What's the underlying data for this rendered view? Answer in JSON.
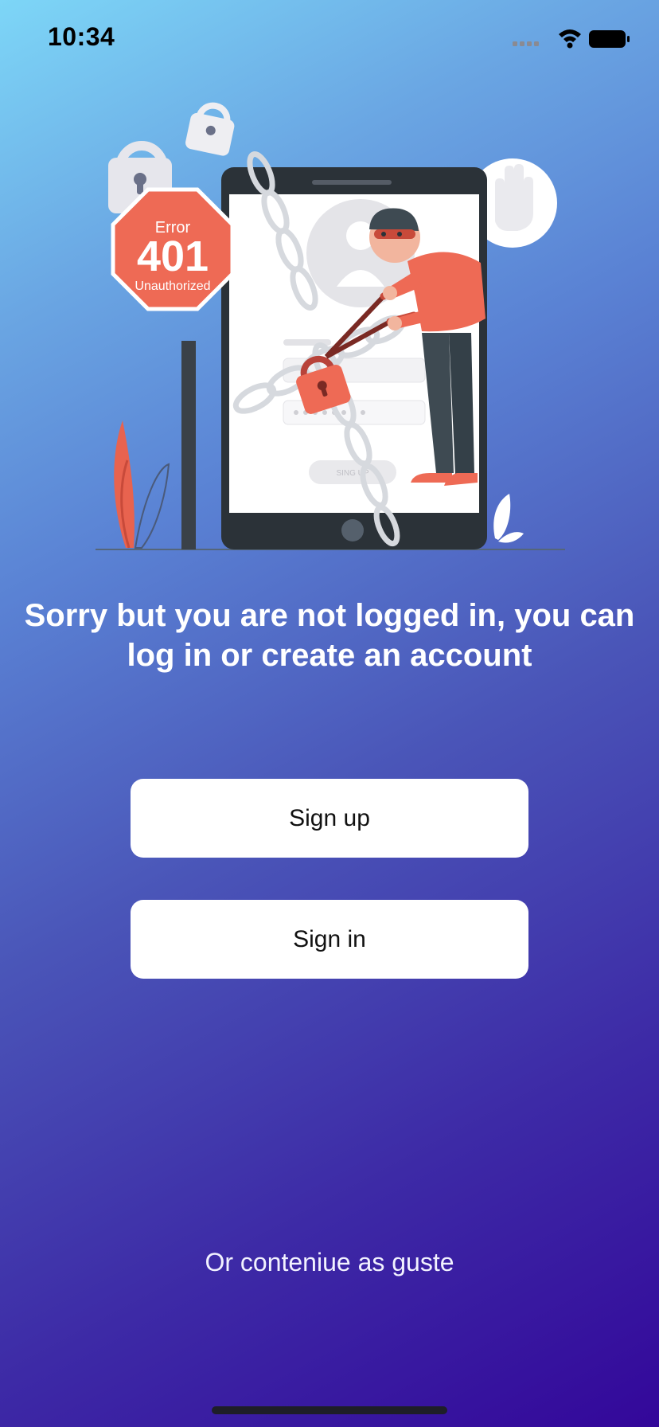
{
  "status_bar": {
    "time": "10:34",
    "icons": [
      "signal-icon",
      "wifi-icon",
      "battery-icon"
    ]
  },
  "illustration": {
    "sign_top": "Error",
    "sign_code": "401",
    "sign_bottom": "Unauthorized",
    "phone_button_label": "SING UP"
  },
  "message": "Sorry but you are not logged in, you can log in or create an account",
  "buttons": {
    "signup_label": "Sign up",
    "signin_label": "Sign in"
  },
  "guest_link": "Or conteniue as guste",
  "colors": {
    "gradient_start": "#7dd6f7",
    "gradient_end": "#33079a",
    "accent_red": "#ee6a55",
    "button_bg": "#ffffff"
  }
}
